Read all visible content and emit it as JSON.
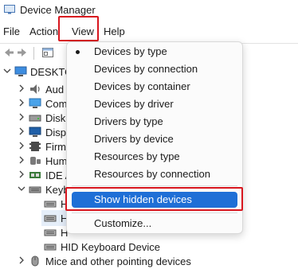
{
  "window": {
    "title": "Device Manager",
    "icon": "device-manager-icon"
  },
  "menubar": {
    "file": "File",
    "action": "Action",
    "view": "View",
    "help": "Help"
  },
  "toolbar": {
    "buttons": [
      "back-arrow-icon",
      "forward-arrow-icon",
      "properties-icon"
    ]
  },
  "tree": {
    "root": "DESKTO",
    "items": [
      {
        "label": "Aud",
        "icon": "audio-icon"
      },
      {
        "label": "Com",
        "icon": "computer-icon"
      },
      {
        "label": "Disk",
        "icon": "disk-drive-icon"
      },
      {
        "label": "Disp",
        "icon": "display-adapter-icon"
      },
      {
        "label": "Firm",
        "icon": "firmware-icon"
      },
      {
        "label": "Hum",
        "icon": "hid-icon"
      },
      {
        "label": "IDE A",
        "icon": "ide-controller-icon"
      },
      {
        "label": "Keyb",
        "icon": "keyboard-icon"
      }
    ],
    "keyboard_children": [
      "H",
      "H",
      "H",
      "HID Keyboard Device"
    ],
    "next_category": "Mice and other pointing devices"
  },
  "view_menu": {
    "items": [
      {
        "label": "Devices by type",
        "checked": true
      },
      {
        "label": "Devices by connection"
      },
      {
        "label": "Devices by container"
      },
      {
        "label": "Devices by driver"
      },
      {
        "label": "Drivers by type"
      },
      {
        "label": "Drivers by device"
      },
      {
        "label": "Resources by type"
      },
      {
        "label": "Resources by connection"
      }
    ],
    "show_hidden": "Show hidden devices",
    "customize": "Customize..."
  },
  "colors": {
    "highlight": "#1f6fd6",
    "annotation": "#d8161e"
  }
}
